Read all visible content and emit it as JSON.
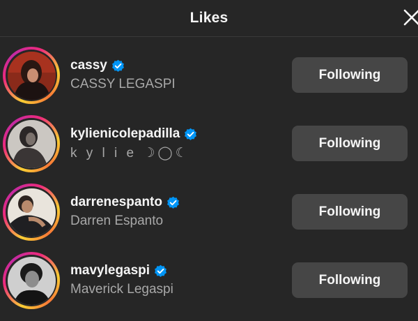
{
  "header": {
    "title": "Likes",
    "close_icon": "close-icon"
  },
  "colors": {
    "background": "#262626",
    "button": "#464646",
    "verified": "#0095f6",
    "secondary_text": "#a8a8a8"
  },
  "likes": [
    {
      "username": "cassy",
      "full_name": "CASSY LEGASPI",
      "verified": true,
      "button_label": "Following"
    },
    {
      "username": "kylienicolepadilla",
      "full_name": "k y l i e ☽◯☾",
      "verified": true,
      "button_label": "Following"
    },
    {
      "username": "darrenespanto",
      "full_name": "Darren Espanto",
      "verified": true,
      "button_label": "Following"
    },
    {
      "username": "mavylegaspi",
      "full_name": "Maverick Legaspi",
      "verified": true,
      "button_label": "Following"
    }
  ]
}
